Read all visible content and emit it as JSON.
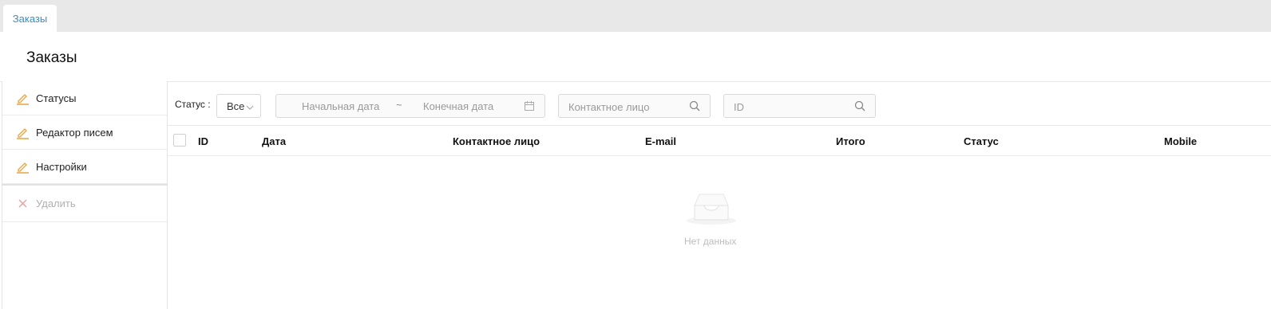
{
  "tabs": [
    {
      "label": "Заказы"
    }
  ],
  "page": {
    "title": "Заказы"
  },
  "sidebar": {
    "items": [
      {
        "label": "Статусы",
        "icon": "pencil-icon"
      },
      {
        "label": "Редактор писем",
        "icon": "pencil-icon"
      },
      {
        "label": "Настройки",
        "icon": "pencil-icon"
      }
    ],
    "delete": {
      "label": "Удалить",
      "icon": "close-icon"
    }
  },
  "filters": {
    "status_label": "Статус :",
    "status_value": "Все",
    "date_start_placeholder": "Начальная дата",
    "date_separator": "~",
    "date_end_placeholder": "Конечная дата",
    "contact_placeholder": "Контактное лицо",
    "id_placeholder": "ID"
  },
  "table": {
    "columns": [
      "ID",
      "Дата",
      "Контактное лицо",
      "E-mail",
      "Итого",
      "Статус",
      "Mobile"
    ],
    "rows": [],
    "empty_text": "Нет данных"
  },
  "colors": {
    "accent": "#3f8bbf",
    "icon_orange": "#e8a33b",
    "delete_icon": "#e8a0a0"
  }
}
